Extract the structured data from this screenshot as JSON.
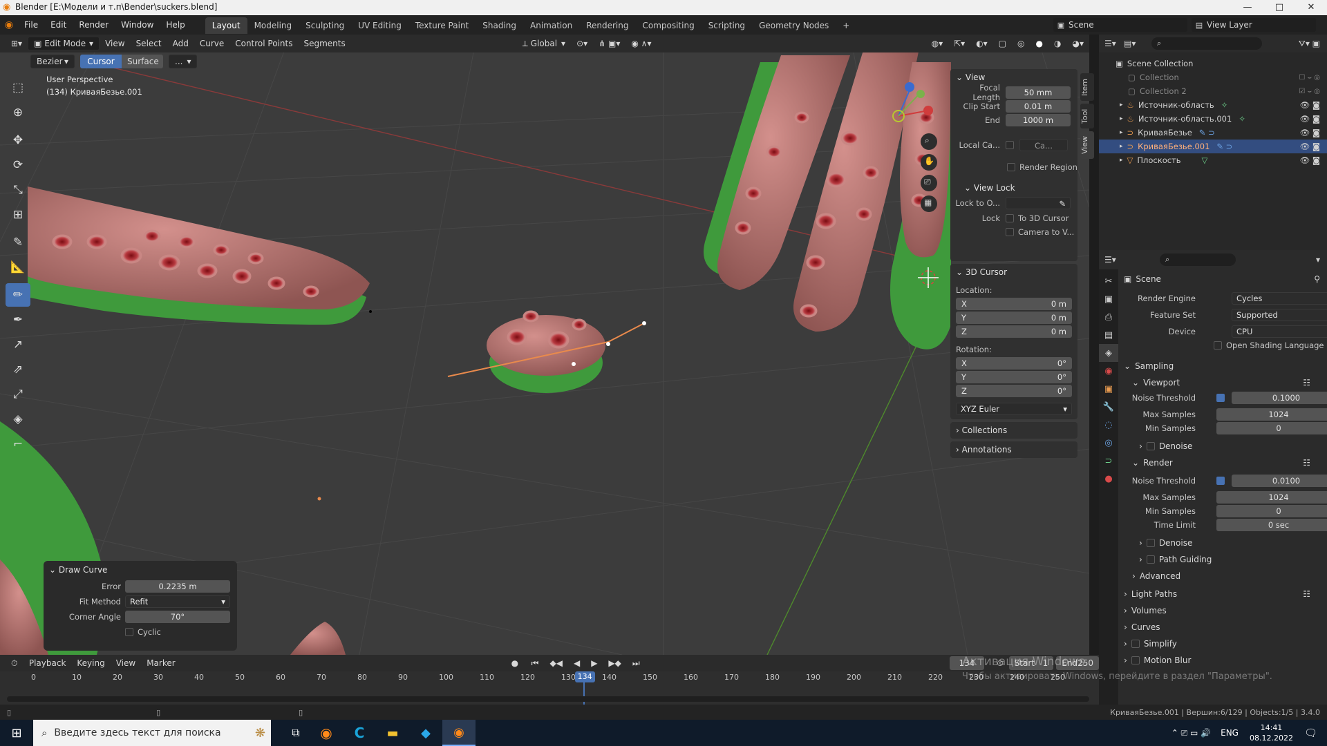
{
  "title_bar": {
    "title": "Blender [E:\\Модели и т.п\\Bender\\suckers.blend]",
    "minimize": "—",
    "maximize": "□",
    "close": "✕"
  },
  "menubar": {
    "menus": [
      "File",
      "Edit",
      "Render",
      "Window",
      "Help"
    ],
    "workspaces": [
      "Layout",
      "Modeling",
      "Sculpting",
      "UV Editing",
      "Texture Paint",
      "Shading",
      "Animation",
      "Rendering",
      "Compositing",
      "Scripting",
      "Geometry Nodes"
    ],
    "active_workspace": "Layout",
    "scene": "Scene",
    "view_layer": "View Layer"
  },
  "viewport_header": {
    "mode": "Edit Mode",
    "menus": [
      "View",
      "Select",
      "Add",
      "Curve",
      "Control Points",
      "Segments"
    ],
    "transform_orientation": "Global",
    "curve_type": "Bezier",
    "tool_buttons": [
      "Cursor",
      "Surface"
    ],
    "more": "..."
  },
  "viewport": {
    "perspective_label": "User Perspective",
    "object_label": "(134) КриваяБезье.001"
  },
  "npanel": {
    "tabs": [
      "Item",
      "Tool",
      "View"
    ],
    "view_section": {
      "title": "View",
      "focal_length_label": "Focal Length",
      "focal_length": "50 mm",
      "clip_start_label": "Clip Start",
      "clip_start": "0.01 m",
      "end_label": "End",
      "end": "1000 m",
      "local_camera_label": "Local Ca...",
      "local_camera_value": "Ca...",
      "render_region": "Render Region"
    },
    "view_lock": {
      "title": "View Lock",
      "lock_to_object_label": "Lock to O...",
      "lock_label": "Lock",
      "to_3d_cursor": "To 3D Cursor",
      "camera_to_view": "Camera to V..."
    },
    "cursor": {
      "title": "3D Cursor",
      "location_label": "Location:",
      "location": [
        {
          "axis": "X",
          "value": "0 m"
        },
        {
          "axis": "Y",
          "value": "0 m"
        },
        {
          "axis": "Z",
          "value": "0 m"
        }
      ],
      "rotation_label": "Rotation:",
      "rotation": [
        {
          "axis": "X",
          "value": "0°"
        },
        {
          "axis": "Y",
          "value": "0°"
        },
        {
          "axis": "Z",
          "value": "0°"
        }
      ],
      "rotation_mode": "XYZ Euler"
    },
    "collections": "Collections",
    "annotations": "Annotations"
  },
  "draw_curve": {
    "title": "Draw Curve",
    "error_label": "Error",
    "error": "0.2235 m",
    "fit_method_label": "Fit Method",
    "fit_method": "Refit",
    "corner_angle_label": "Corner Angle",
    "corner_angle": "70°",
    "cyclic": "Cyclic"
  },
  "outliner": {
    "root": "Scene Collection",
    "items": [
      {
        "name": "Collection",
        "dim": true
      },
      {
        "name": "Collection 2",
        "dim": true
      },
      {
        "name": "Источник-область",
        "dim": false
      },
      {
        "name": "Источник-область.001",
        "dim": false
      },
      {
        "name": "КриваяБезье",
        "dim": false
      },
      {
        "name": "КриваяБезье.001",
        "dim": false,
        "selected": true
      },
      {
        "name": "Плоскость",
        "dim": false
      }
    ]
  },
  "properties": {
    "scene": "Scene",
    "render_engine_label": "Render Engine",
    "render_engine": "Cycles",
    "feature_set_label": "Feature Set",
    "feature_set": "Supported",
    "device_label": "Device",
    "device": "CPU",
    "osl": "Open Shading Language",
    "sampling": "Sampling",
    "viewport": "Viewport",
    "v_noise_label": "Noise Threshold",
    "v_noise": "0.1000",
    "v_max_label": "Max Samples",
    "v_max": "1024",
    "v_min_label": "Min Samples",
    "v_min": "0",
    "denoise": "Denoise",
    "render": "Render",
    "r_noise_label": "Noise Threshold",
    "r_noise": "0.0100",
    "r_max_label": "Max Samples",
    "r_max": "1024",
    "r_min_label": "Min Samples",
    "r_min": "0",
    "r_time_label": "Time Limit",
    "r_time": "0 sec",
    "denoise2": "Denoise",
    "path_guiding": "Path Guiding",
    "advanced": "Advanced",
    "light_paths": "Light Paths",
    "volumes": "Volumes",
    "curves": "Curves",
    "simplify": "Simplify",
    "motion_blur": "Motion Blur"
  },
  "timeline": {
    "menus": [
      "Playback",
      "Keying",
      "View",
      "Marker"
    ],
    "current_frame": "134",
    "start_label": "Start",
    "start": "1",
    "end_label": "End",
    "end": "250",
    "ticks": [
      "0",
      "10",
      "20",
      "30",
      "40",
      "50",
      "60",
      "70",
      "80",
      "90",
      "100",
      "110",
      "120",
      "130",
      "140",
      "150",
      "160",
      "170",
      "180",
      "190",
      "200",
      "210",
      "220",
      "230",
      "240",
      "250"
    ],
    "playhead": 134
  },
  "watermark": {
    "line1": "Активация Windows",
    "line2": "Чтобы активировать Windows, перейдите в раздел \"Параметры\"."
  },
  "statusbar": {
    "info": "КриваяБезье.001 | Вершин:6/129 | Objects:1/5 | 3.4.0"
  },
  "taskbar": {
    "search_placeholder": "Введите здесь текст для поиска",
    "lang": "ENG",
    "time": "14:41",
    "date": "08.12.2022"
  },
  "colors": {
    "accent": "#4772b3",
    "viewport_bg": "#3c3c3c",
    "tentacle": "#b87672",
    "green": "#3f9a3c"
  }
}
